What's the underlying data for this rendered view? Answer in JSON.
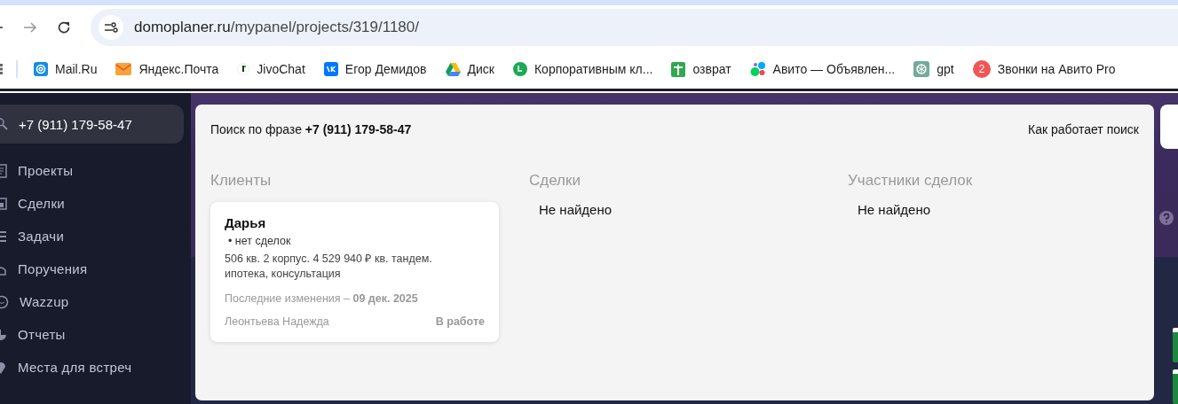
{
  "browser": {
    "url_host": "domoplaner.ru",
    "url_path": "/mypanel/projects/319/1180/",
    "bookmarks": [
      {
        "label": "Mail.Ru"
      },
      {
        "label": "Яндекс.Почта"
      },
      {
        "label": "JivoChat"
      },
      {
        "label": "Егор Демидов"
      },
      {
        "label": "Диск"
      },
      {
        "label": "Корпоративным кл..."
      },
      {
        "label": "озврат"
      },
      {
        "label": "Авито — Объявлен..."
      },
      {
        "label": "gpt"
      },
      {
        "label": "Звонки на Авито Pro",
        "badge": "2"
      }
    ]
  },
  "sidebar": {
    "search": {
      "value": "+7 (911) 179-58-47"
    },
    "items": [
      {
        "label": "Проекты"
      },
      {
        "label": "Сделки"
      },
      {
        "label": "Задачи"
      },
      {
        "label": "Поручения"
      },
      {
        "label": "Wazzup"
      },
      {
        "label": "Отчеты"
      },
      {
        "label": "Места для встреч"
      }
    ]
  },
  "search_panel": {
    "phrase": "Поиск по фразе **+7 (911) 179-58-47**",
    "help_link": "Как работает поиск",
    "sections": [
      {
        "title": "Клиенты",
        "results": [
          {
            "name": "Дарья",
            "deals": "• нет сделок",
            "description": "506 кв. 2 корпус. 4 529 940 ₽ кв. тандем. ипотека, консультация",
            "updated": "Последние изменения – **09 дек. 2025**",
            "manager": "Леонтьева Надежда",
            "status": "В работе"
          }
        ]
      },
      {
        "title": "Сделки",
        "empty": "Не найдено"
      },
      {
        "title": "Участники сделок",
        "empty": "Не найдено"
      }
    ]
  }
}
